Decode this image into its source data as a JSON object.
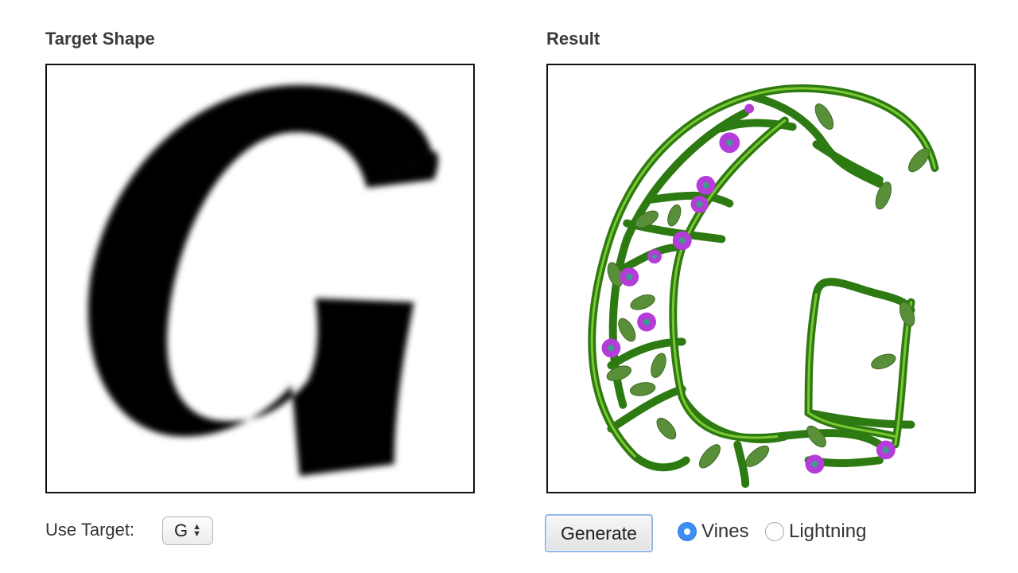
{
  "left_panel": {
    "title": "Target Shape"
  },
  "right_panel": {
    "title": "Result"
  },
  "controls": {
    "use_target_label": "Use Target:",
    "target_value": "G",
    "generate_label": "Generate",
    "style_options": [
      {
        "label": "Vines",
        "selected": true
      },
      {
        "label": "Lightning",
        "selected": false
      }
    ]
  },
  "colors": {
    "vine": "#3f9a1c",
    "vine_highlight": "#8fdc3a",
    "leaf": "#5a8f3a",
    "flower": "#b43cd8",
    "flower_center": "#3aa08a",
    "radio_selected": "#3d8ef0"
  }
}
